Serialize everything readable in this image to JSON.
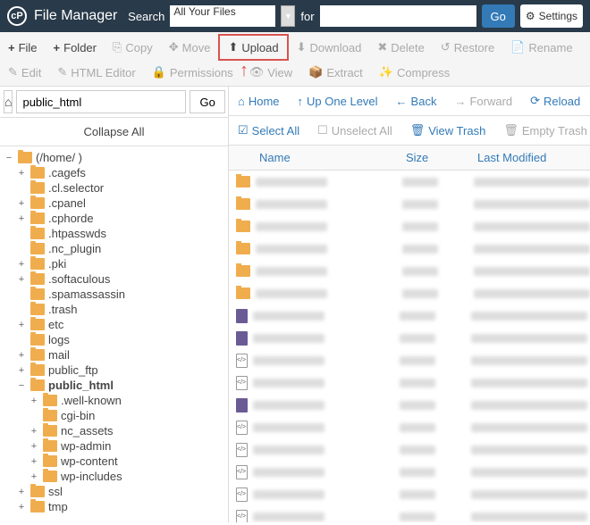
{
  "header": {
    "app_title": "File Manager",
    "search_label": "Search",
    "search_scope": "All Your Files",
    "for_label": "for",
    "go": "Go",
    "settings": "Settings"
  },
  "toolbar": {
    "file": "File",
    "folder": "Folder",
    "copy": "Copy",
    "move": "Move",
    "upload": "Upload",
    "download": "Download",
    "delete": "Delete",
    "restore": "Restore",
    "rename": "Rename",
    "edit": "Edit",
    "html_editor": "HTML Editor",
    "permissions": "Permissions",
    "view": "View",
    "extract": "Extract",
    "compress": "Compress"
  },
  "sidebar": {
    "path": "public_html",
    "go": "Go",
    "collapse_all": "Collapse All",
    "tree": [
      {
        "exp": "−",
        "label": "(/home/          )",
        "ind": 0,
        "open": true,
        "blur": false
      },
      {
        "exp": "+",
        "label": ".cagefs",
        "ind": 1
      },
      {
        "exp": "",
        "label": ".cl.selector",
        "ind": 1,
        "noexp": true
      },
      {
        "exp": "+",
        "label": ".cpanel",
        "ind": 1
      },
      {
        "exp": "+",
        "label": ".cphorde",
        "ind": 1
      },
      {
        "exp": "",
        "label": ".htpasswds",
        "ind": 1,
        "noexp": true
      },
      {
        "exp": "",
        "label": ".nc_plugin",
        "ind": 1,
        "noexp": true
      },
      {
        "exp": "+",
        "label": ".pki",
        "ind": 1
      },
      {
        "exp": "+",
        "label": ".softaculous",
        "ind": 1
      },
      {
        "exp": "",
        "label": ".spamassassin",
        "ind": 1,
        "noexp": true
      },
      {
        "exp": "",
        "label": ".trash",
        "ind": 1,
        "noexp": true
      },
      {
        "exp": "+",
        "label": "etc",
        "ind": 1
      },
      {
        "exp": "",
        "label": "logs",
        "ind": 1,
        "noexp": true
      },
      {
        "exp": "+",
        "label": "mail",
        "ind": 1
      },
      {
        "exp": "+",
        "label": "public_ftp",
        "ind": 1
      },
      {
        "exp": "−",
        "label": "public_html",
        "ind": 1,
        "bold": true,
        "open": true
      },
      {
        "exp": "+",
        "label": ".well-known",
        "ind": 2
      },
      {
        "exp": "",
        "label": "cgi-bin",
        "ind": 2,
        "noexp": true
      },
      {
        "exp": "+",
        "label": "nc_assets",
        "ind": 2
      },
      {
        "exp": "+",
        "label": "wp-admin",
        "ind": 2
      },
      {
        "exp": "+",
        "label": "wp-content",
        "ind": 2
      },
      {
        "exp": "+",
        "label": "wp-includes",
        "ind": 2
      },
      {
        "exp": "+",
        "label": "ssl",
        "ind": 1
      },
      {
        "exp": "+",
        "label": "tmp",
        "ind": 1
      }
    ]
  },
  "actionbar": {
    "home": "Home",
    "up": "Up One Level",
    "back": "Back",
    "forward": "Forward",
    "reload": "Reload",
    "select_all": "Select All",
    "unselect_all": "Unselect All",
    "view_trash": "View Trash",
    "empty_trash": "Empty Trash"
  },
  "table": {
    "headers": {
      "name": "Name",
      "size": "Size",
      "modified": "Last Modified"
    },
    "rows": [
      {
        "type": "folder"
      },
      {
        "type": "folder"
      },
      {
        "type": "folder"
      },
      {
        "type": "folder"
      },
      {
        "type": "folder"
      },
      {
        "type": "folder"
      },
      {
        "type": "doc"
      },
      {
        "type": "doc"
      },
      {
        "type": "code"
      },
      {
        "type": "code"
      },
      {
        "type": "doc"
      },
      {
        "type": "code"
      },
      {
        "type": "code"
      },
      {
        "type": "code"
      },
      {
        "type": "code"
      },
      {
        "type": "code"
      }
    ]
  }
}
